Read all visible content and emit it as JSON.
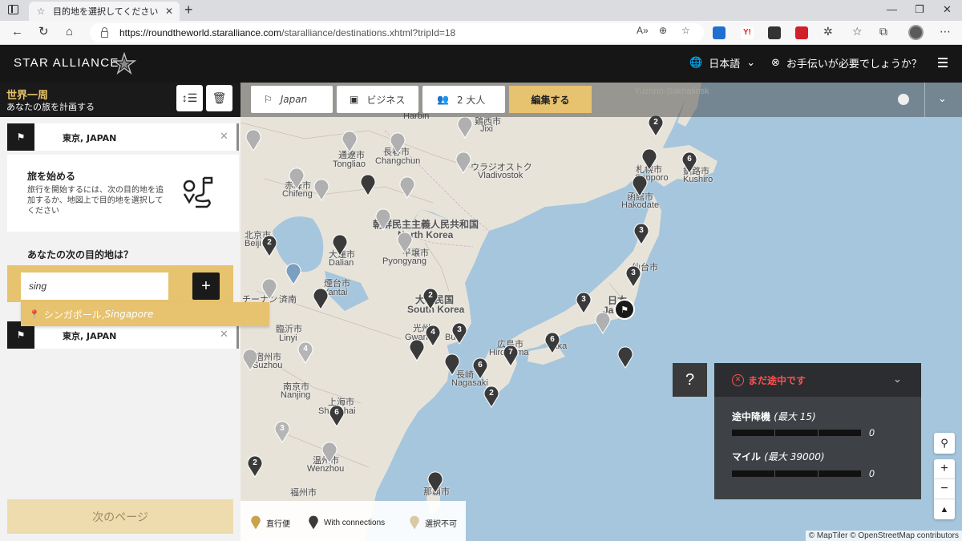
{
  "browser": {
    "tab_title": "目的地を選択してください",
    "url_host": "https://roundtheworld.staralliance.com",
    "url_path": "/staralliance/destinations.xhtml?tripId=18"
  },
  "header": {
    "logo": "STAR ALLIANCE",
    "language": "日本語",
    "help": "お手伝いが必要でしょうか？"
  },
  "panel": {
    "title": "世界一周",
    "subtitle": "あなたの旅を計画する",
    "origin_city": "東京, JAPAN",
    "start_title": "旅を始める",
    "start_text": "旅行を開始するには、次の目的地を追加するか、地図上で目的地を選択してください",
    "next_question": "あなたの次の目的地は？",
    "search_value": "sing",
    "suggestion_city": "シンガポール, ",
    "suggestion_country": "Singapore",
    "return_city": "東京, JAPAN",
    "next_button": "次のページ"
  },
  "toolbar": {
    "country": "Japan",
    "cabin": "ビジネス",
    "passengers": "2 大人",
    "edit": "編集する"
  },
  "map": {
    "labels": [
      {
        "id": "harbin",
        "text": "Harbin"
      },
      {
        "id": "jixi",
        "text": "鶏西市"
      },
      {
        "id": "jixi_en",
        "text": "Jixi"
      },
      {
        "id": "tongliao_jp",
        "text": "通遼市"
      },
      {
        "id": "tongliao",
        "text": "Tongliao"
      },
      {
        "id": "changchun_jp",
        "text": "長春市"
      },
      {
        "id": "changchun",
        "text": "Changchun"
      },
      {
        "id": "vladivostok_jp",
        "text": "ウラジオストク"
      },
      {
        "id": "vladivostok",
        "text": "Vladivostok"
      },
      {
        "id": "chifeng_jp",
        "text": "赤峰市"
      },
      {
        "id": "chifeng",
        "text": "Chifeng"
      },
      {
        "id": "nk_jp",
        "text": "朝鮮民主主義人民共和国"
      },
      {
        "id": "nk",
        "text": "North Korea"
      },
      {
        "id": "beijing_jp",
        "text": "北京市"
      },
      {
        "id": "beijing",
        "text": "Beiji"
      },
      {
        "id": "dalian_jp",
        "text": "大連市"
      },
      {
        "id": "dalian",
        "text": "Dalian"
      },
      {
        "id": "pyongyang_jp",
        "text": "平壌市"
      },
      {
        "id": "pyongyang",
        "text": "Pyongyang"
      },
      {
        "id": "yantai_jp",
        "text": "煙台市"
      },
      {
        "id": "yantai",
        "text": "Yantai"
      },
      {
        "id": "tianjin_jp",
        "text": "チーナン"
      },
      {
        "id": "jinan_jp",
        "text": "済南"
      },
      {
        "id": "sk_jp",
        "text": "大韓民国"
      },
      {
        "id": "sk",
        "text": "South Korea"
      },
      {
        "id": "linyi_jp",
        "text": "臨沂市"
      },
      {
        "id": "linyi",
        "text": "Linyi"
      },
      {
        "id": "gwangju_jp",
        "text": "光州"
      },
      {
        "id": "gwangju",
        "text": "Gwan"
      },
      {
        "id": "busan",
        "text": "Bu"
      },
      {
        "id": "suzhou_jp",
        "text": "宿州市"
      },
      {
        "id": "suzhou",
        "text": "Suzhou"
      },
      {
        "id": "nanjing_jp",
        "text": "南京市"
      },
      {
        "id": "nanjing",
        "text": "Nanjing"
      },
      {
        "id": "shanghai_jp",
        "text": "上海市"
      },
      {
        "id": "shanghai",
        "text": "Shanghai"
      },
      {
        "id": "nagasaki_jp",
        "text": "長崎"
      },
      {
        "id": "nagasaki",
        "text": "Nagasaki"
      },
      {
        "id": "hiroshima_jp",
        "text": "広島市"
      },
      {
        "id": "hiroshima",
        "text": "Hiroshima"
      },
      {
        "id": "osaka",
        "text": "saka"
      },
      {
        "id": "wenzhou_jp",
        "text": "温州市"
      },
      {
        "id": "wenzhou",
        "text": "Wenzhou"
      },
      {
        "id": "fuzhou_jp",
        "text": "福州市"
      },
      {
        "id": "taipei_jp",
        "text": "那覇市"
      },
      {
        "id": "sapporo_jp",
        "text": "札幌市"
      },
      {
        "id": "sapporo",
        "text": "Sapporo"
      },
      {
        "id": "hakodate_jp",
        "text": "函館市"
      },
      {
        "id": "hakodate",
        "text": "Hakodate"
      },
      {
        "id": "kushiro_jp",
        "text": "釧路市"
      },
      {
        "id": "kushiro",
        "text": "Kushiro"
      },
      {
        "id": "sendai_jp",
        "text": "仙台市"
      },
      {
        "id": "japan_jp",
        "text": "日本"
      },
      {
        "id": "japan",
        "text": "Ja"
      },
      {
        "id": "yuzhno",
        "text": "Yuzhno-Sakhalinsk"
      }
    ],
    "markers": [
      {
        "id": "m1",
        "type": "connection",
        "count": "2"
      },
      {
        "id": "m2",
        "type": "connection",
        "count": "6"
      },
      {
        "id": "m3",
        "type": "connection",
        "count": "3"
      },
      {
        "id": "m4",
        "type": "connection",
        "count": "3"
      },
      {
        "id": "m5",
        "type": "connection",
        "count": "3"
      },
      {
        "id": "m6",
        "type": "connection",
        "count": "6"
      },
      {
        "id": "m7",
        "type": "connection",
        "count": "7"
      },
      {
        "id": "m8",
        "type": "connection",
        "count": "2"
      },
      {
        "id": "m9",
        "type": "connection",
        "count": "4"
      },
      {
        "id": "m10",
        "type": "connection",
        "count": "3"
      },
      {
        "id": "m11",
        "type": "connection",
        "count": "6"
      },
      {
        "id": "m12",
        "type": "connection",
        "count": "2"
      },
      {
        "id": "m13",
        "type": "connection",
        "count": "2"
      },
      {
        "id": "m14",
        "type": "connection",
        "count": "6"
      },
      {
        "id": "m15",
        "type": "connection",
        "count": "2"
      },
      {
        "id": "m16",
        "type": "unavailable",
        "count": "4"
      },
      {
        "id": "m17",
        "type": "unavailable",
        "count": "3"
      }
    ],
    "legend": {
      "direct": "直行便",
      "connections": "With connections",
      "unavailable": "選択不可"
    },
    "attribution": "© MapTiler © OpenStreetMap contributors"
  },
  "status": {
    "question": "?",
    "title": "まだ途中です",
    "stopovers_label": "途中降機",
    "stopovers_max": "(最大 15)",
    "stopovers_value": "0",
    "miles_label": "マイル",
    "miles_max": "(最大 39000)",
    "miles_value": "0"
  },
  "colors": {
    "gold": "#e7c26f",
    "dark": "#1a1a1a",
    "sea": "#a5c6dd",
    "land": "#e8e3d9",
    "error": "#ff5050"
  }
}
